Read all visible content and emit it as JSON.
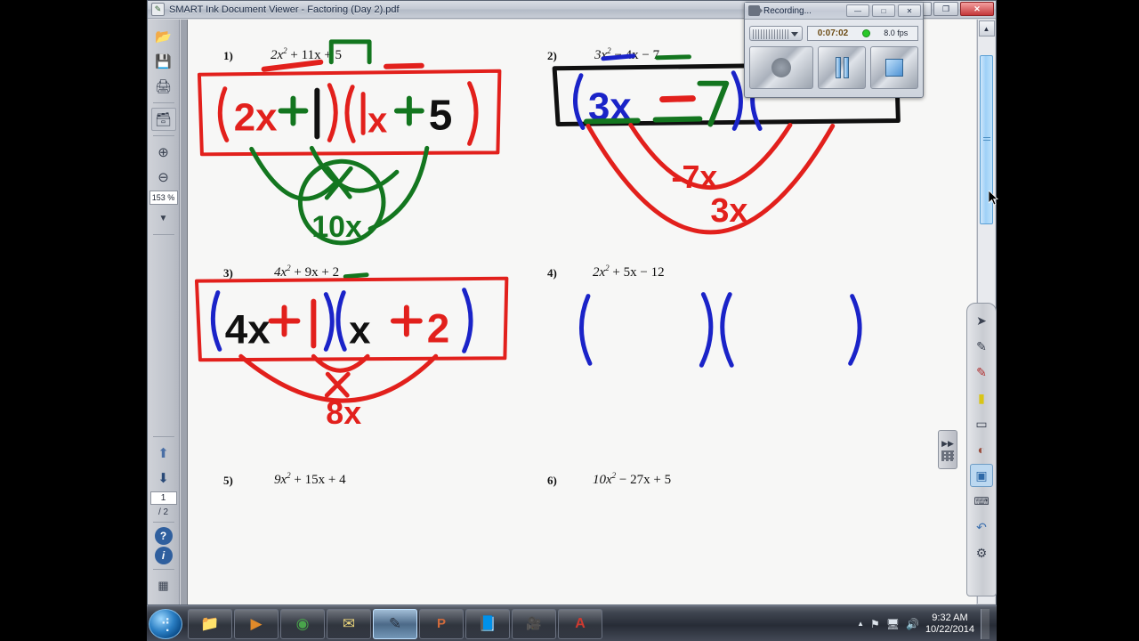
{
  "window": {
    "title": "SMART Ink Document Viewer - Factoring (Day 2).pdf",
    "icon": "smart-ink-icon",
    "controls": {
      "minimize": "—",
      "restore": "❐",
      "close": "✕"
    }
  },
  "left_toolbar": {
    "items": [
      {
        "name": "open-file-button",
        "icon": "folder-open-icon",
        "glyph": "📂"
      },
      {
        "name": "save-button",
        "icon": "save-icon",
        "glyph": "💾"
      },
      {
        "name": "print-button",
        "icon": "printer-icon",
        "glyph": "🖨"
      },
      {
        "name": "attachments-button",
        "icon": "attachments-icon",
        "glyph": "🗂"
      },
      {
        "name": "zoom-in-button",
        "icon": "zoom-in-icon",
        "glyph": "⊕"
      },
      {
        "name": "zoom-out-button",
        "icon": "zoom-out-icon",
        "glyph": "⊖"
      }
    ],
    "zoom_level": "153 %",
    "zoom_dropdown_glyph": "▼",
    "page_up_glyph": "⬆",
    "page_down_glyph": "⬇",
    "current_page": "1",
    "page_total": "/ 2",
    "help_glyph": "?",
    "info_glyph": "i",
    "settings_icon": "page-settings-icon"
  },
  "document": {
    "problems": [
      {
        "number": "1)",
        "expr_a": "2x",
        "exp": "2",
        "expr_b": " + 11x + 5"
      },
      {
        "number": "2)",
        "expr_a": "3x",
        "exp": "2",
        "expr_b": " − 4x − 7"
      },
      {
        "number": "3)",
        "expr_a": "4x",
        "exp": "2",
        "expr_b": " + 9x + 2"
      },
      {
        "number": "4)",
        "expr_a": "2x",
        "exp": "2",
        "expr_b": " + 5x − 12"
      },
      {
        "number": "5)",
        "expr_a": "9x",
        "exp": "2",
        "expr_b": " + 15x + 4"
      },
      {
        "number": "6)",
        "expr_a": "10x",
        "exp": "2",
        "expr_b": " − 27x + 5"
      }
    ],
    "ink_annotations": {
      "problem1_answer": "(2x + 1)(1x + 5)",
      "problem1_arc_labels": [
        "x",
        "10x"
      ],
      "problem2_answer": "(3x − 7)(",
      "problem2_arc_labels": [
        "-7x",
        "3x"
      ],
      "problem3_answer": "(4x + 1)(x + 2)",
      "problem3_arc_labels": [
        "x",
        "8x"
      ],
      "problem4_answer": "(        )(        )"
    },
    "ink_colors": {
      "red": "#e2201c",
      "green": "#13761f",
      "blue": "#1a23c8",
      "black": "#101010"
    }
  },
  "scrollbar": {
    "up_glyph": "▲",
    "down_glyph": "▼"
  },
  "recording_window": {
    "title": "Recording...",
    "icon": "video-camera-icon",
    "controls": {
      "minimize": "—",
      "restore": "□",
      "close": "✕"
    },
    "elapsed_time": "0:07:02",
    "frame_rate": "8.0 fps",
    "status_color": "#28c828",
    "buttons": [
      {
        "name": "record-button",
        "icon": "record-icon"
      },
      {
        "name": "pause-button",
        "icon": "pause-icon"
      },
      {
        "name": "stop-button",
        "icon": "stop-icon"
      }
    ]
  },
  "ink_toolbar": {
    "items": [
      {
        "name": "select-tool",
        "icon": "cursor-arrow-icon",
        "glyph": "➤"
      },
      {
        "name": "pen-tool",
        "icon": "pen-icon",
        "glyph": "✎"
      },
      {
        "name": "creative-pen-tool",
        "icon": "red-pen-icon",
        "glyph": "✒"
      },
      {
        "name": "highlighter-tool",
        "icon": "highlighter-icon",
        "glyph": "▰"
      },
      {
        "name": "eraser-tool",
        "icon": "eraser-icon",
        "glyph": "▭"
      },
      {
        "name": "ink-settings-tool",
        "icon": "ink-palette-icon",
        "glyph": "◐"
      },
      {
        "name": "screen-capture-tool",
        "icon": "screen-capture-icon",
        "glyph": "▣"
      },
      {
        "name": "keyboard-tool",
        "icon": "keyboard-icon",
        "glyph": "⌨"
      },
      {
        "name": "undo-tool",
        "icon": "undo-arrow-icon",
        "glyph": "↶"
      },
      {
        "name": "settings-tool",
        "icon": "gear-icon",
        "glyph": "⚙"
      }
    ],
    "selected_index": 6,
    "handle_glyph": "▶▶"
  },
  "taskbar": {
    "start_glyph": "⊚",
    "items": [
      {
        "name": "taskbar-file-explorer",
        "icon": "folder-icon",
        "glyph": "📁",
        "active": false
      },
      {
        "name": "taskbar-media-player",
        "icon": "media-player-icon",
        "glyph": "▶",
        "active": false
      },
      {
        "name": "taskbar-chrome",
        "icon": "chrome-icon",
        "glyph": "◉",
        "active": false
      },
      {
        "name": "taskbar-outlook",
        "icon": "outlook-icon",
        "glyph": "✉",
        "active": false
      },
      {
        "name": "taskbar-smart-ink",
        "icon": "smart-ink-icon",
        "glyph": "✎",
        "active": true
      },
      {
        "name": "taskbar-powerpoint",
        "icon": "powerpoint-icon",
        "glyph": "P",
        "active": false
      },
      {
        "name": "taskbar-smart-notebook",
        "icon": "notebook-icon",
        "glyph": "📘",
        "active": false
      },
      {
        "name": "taskbar-recorder",
        "icon": "video-camera-icon",
        "glyph": "📷",
        "active": false
      },
      {
        "name": "taskbar-adobe-reader",
        "icon": "adobe-reader-icon",
        "glyph": "A",
        "active": false
      }
    ],
    "tray": {
      "expand_glyph": "▲",
      "flag_glyph": "⚑",
      "network_glyph": "🖧",
      "volume_glyph": "🔊",
      "time": "9:32 AM",
      "date": "10/22/2014"
    }
  }
}
